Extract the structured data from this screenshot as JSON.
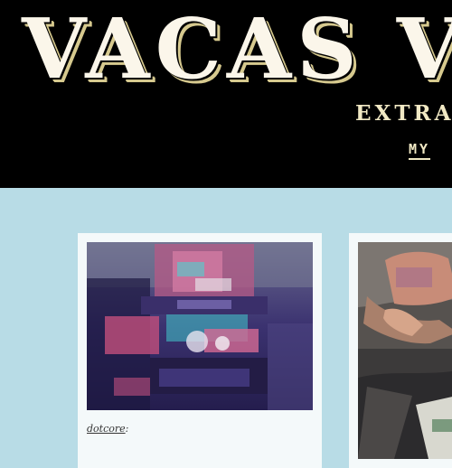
{
  "header": {
    "title": "VACAS V",
    "tagline": "EXTRA",
    "link": "MY"
  },
  "posts": [
    {
      "image": "glitched-game-boy-color-photo",
      "author": "dotcore",
      "author_suffix": ":"
    },
    {
      "image": "person-lying-on-couch-photo"
    }
  ],
  "colors": {
    "header_bg": "#000000",
    "title": "#fbf6ea",
    "title_shadow": "#d6c98e",
    "page_bg": "#b8dce6",
    "card_bg": "#f4f9fa"
  }
}
